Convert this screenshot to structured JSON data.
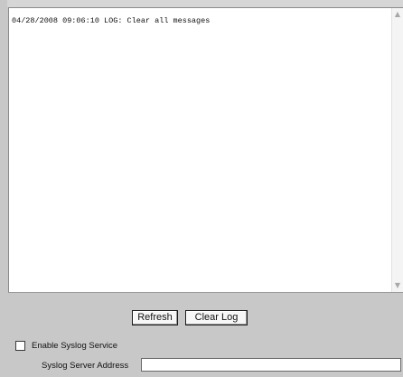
{
  "log": {
    "text": "04/28/2008 09:06:10 LOG: Clear all messages"
  },
  "buttons": {
    "refresh_label": "Refresh",
    "clear_log_label": "Clear Log"
  },
  "syslog": {
    "enable_label": "Enable Syslog Service",
    "enable_checked": false,
    "server_address_label": "Syslog Server Address",
    "server_address_value": ""
  },
  "icons": {
    "scroll_up": "chevron-up-icon",
    "scroll_down": "chevron-down-icon"
  }
}
